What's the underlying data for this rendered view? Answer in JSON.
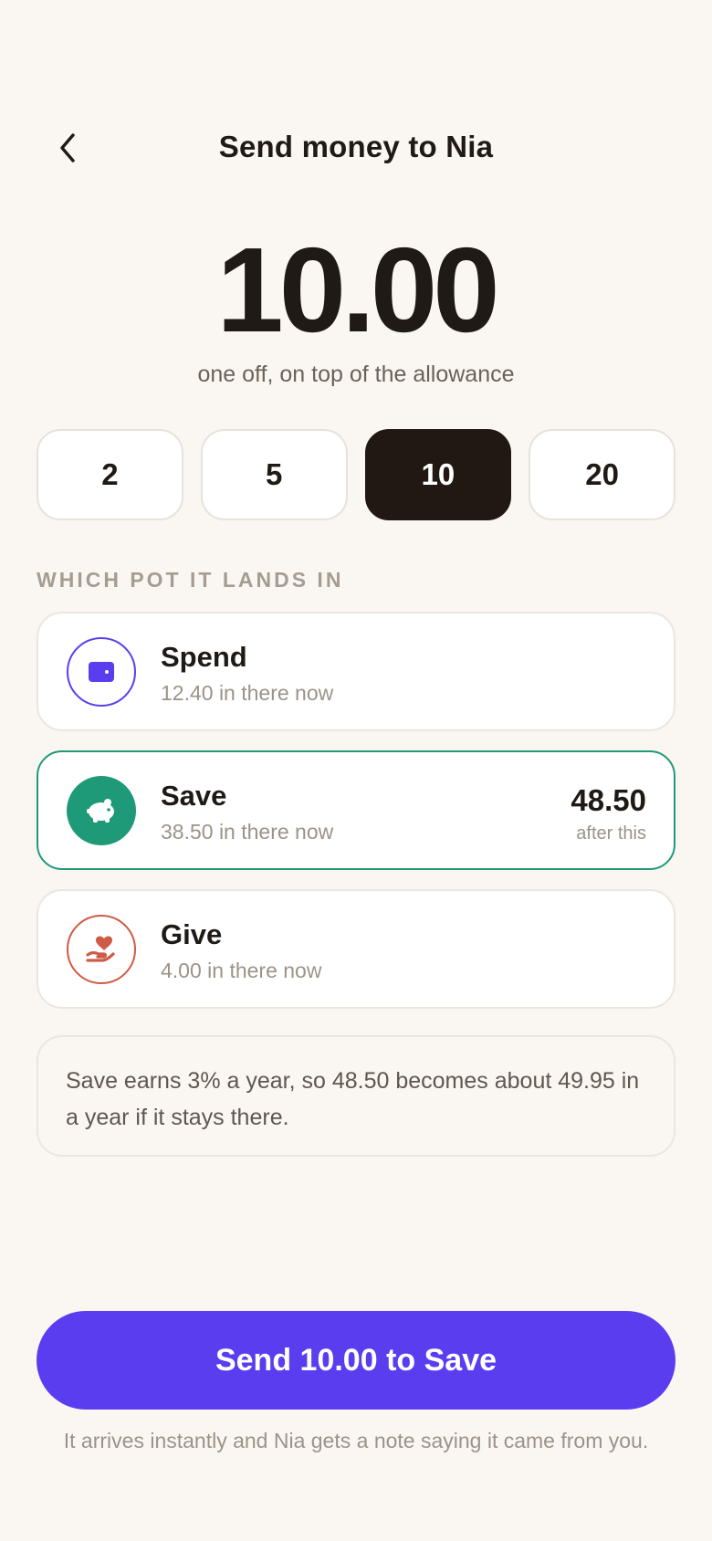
{
  "header": {
    "title": "Send money to Nia",
    "back_icon": "chevron-left-icon"
  },
  "amount": {
    "value": "10.00",
    "subtitle": "one off, on top of the allowance"
  },
  "presets": [
    {
      "label": "2",
      "selected": false
    },
    {
      "label": "5",
      "selected": false
    },
    {
      "label": "10",
      "selected": true
    },
    {
      "label": "20",
      "selected": false
    }
  ],
  "pots_section_label": "WHICH POT IT LANDS IN",
  "pots": [
    {
      "name": "Spend",
      "balance_text": "12.40 in there now",
      "icon": "wallet-icon",
      "color": "#5b3df0",
      "selected": false
    },
    {
      "name": "Save",
      "balance_text": "38.50 in there now",
      "icon": "piggy-bank-icon",
      "color": "#1f9a78",
      "selected": true,
      "after_value": "48.50",
      "after_label": "after this"
    },
    {
      "name": "Give",
      "balance_text": "4.00 in there now",
      "icon": "heart-hand-icon",
      "color": "#cf5a46",
      "selected": false
    }
  ],
  "info_text": "Save earns 3% a year, so 48.50 becomes about 49.95 in a year if it stays there.",
  "cta": {
    "label": "Send 10.00 to Save",
    "color": "#5b3df0"
  },
  "footnote": "It arrives instantly and Nia gets a note saying it came from you."
}
